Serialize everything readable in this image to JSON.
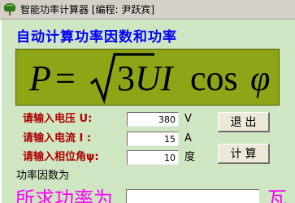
{
  "window": {
    "title": "智能功率计算器 [编程: 尹跃宾]",
    "icon": "tree-icon"
  },
  "heading": "自动计算功率因数和功率",
  "formula": {
    "lhs": "P",
    "equals": "=",
    "radicand": "3",
    "vars": "UI",
    "func": "cos",
    "phi": "φ"
  },
  "inputs": [
    {
      "label": "请输入电压 U:",
      "value": "380",
      "unit": "V"
    },
    {
      "label": "请输入电流 I :",
      "value": "15",
      "unit": "A"
    },
    {
      "label": "请输入相位角ψ:",
      "value": "10",
      "unit": "度"
    }
  ],
  "buttons": {
    "exit": "退出",
    "calc": "计算"
  },
  "result": {
    "pf_label": "功率因数为",
    "power_label": "所求功率为",
    "power_unit": "瓦"
  },
  "colors": {
    "background": "#cfe6c2",
    "formula_panel": "#8ea615",
    "heading": "#0000ff",
    "labels": "#b00000",
    "result_text": "#ff00ff"
  }
}
